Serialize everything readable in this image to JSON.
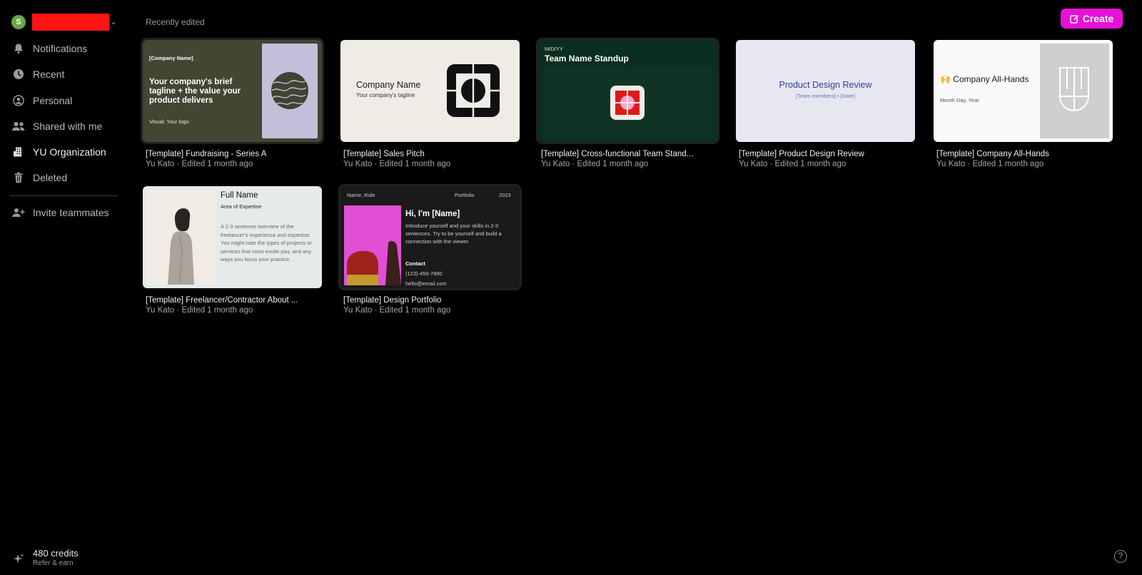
{
  "sidebar": {
    "workspace_avatar_letter": "S",
    "items": [
      {
        "label": "Notifications",
        "icon": "bell-icon"
      },
      {
        "label": "Recent",
        "icon": "clock-icon"
      },
      {
        "label": "Personal",
        "icon": "person-icon"
      },
      {
        "label": "Shared with me",
        "icon": "people-icon"
      },
      {
        "label": "YU Organization",
        "icon": "building-icon"
      },
      {
        "label": "Deleted",
        "icon": "trash-icon"
      },
      {
        "label": "Invite teammates",
        "icon": "add-person-icon"
      }
    ],
    "credits": {
      "count": "480 credits",
      "sub": "Refer & earn",
      "icon": "sparkle-icon"
    }
  },
  "main": {
    "section_title": "Recently edited",
    "create_label": "Create",
    "accent": "#e810d8",
    "cards": [
      {
        "title": "[Template] Fundraising - Series A",
        "meta": "Yu Kato · Edited 1 month ago",
        "thumb": {
          "label": "[Company Name]",
          "headline": "Your company's brief tagline + the value your product delivers",
          "foot": "Visual: Your logo"
        }
      },
      {
        "title": "[Template] Sales Pitch",
        "meta": "Yu Kato · Edited 1 month ago",
        "thumb": {
          "name": "Company Name",
          "tagline": "Your company's tagline"
        }
      },
      {
        "title": "[Template] Cross-functional Team Stand...",
        "meta": "Yu Kato · Edited 1 month ago",
        "thumb": {
          "date": "M/D/YY",
          "heading": "Team Name Standup"
        }
      },
      {
        "title": "[Template] Product Design Review",
        "meta": "Yu Kato · Edited 1 month ago",
        "thumb": {
          "heading": "Product Design Review",
          "sub": "[Team members] • [Date]"
        }
      },
      {
        "title": "[Template] Company All-Hands",
        "meta": "Yu Kato · Edited 1 month ago",
        "thumb": {
          "emoji": "🙌",
          "heading": "Company All-Hands",
          "date": "Month Day, Year"
        }
      },
      {
        "title": "[Template] Freelancer/Contractor About ...",
        "meta": "Yu Kato · Edited 1 month ago",
        "thumb": {
          "name": "Full Name",
          "area": "Area of Expertise",
          "body": "A 2-3 sentence overview of the freelancer's experience and expertise. You might note the types of projects or services that most excite you, and any ways you focus your practice."
        }
      },
      {
        "title": "[Template] Design Portfolio",
        "meta": "Yu Kato · Edited 1 month ago",
        "thumb": {
          "role": "Name, Role",
          "portfolio": "Portfolio",
          "year": "2023",
          "heading": "Hi, I'm [Name]",
          "intro": "Introduce yourself and your skills in 2-3 sentences. Try to be yourself and build a connection with the viewer.",
          "contact": "Contact",
          "phone": "(123)-456-7890",
          "email": "hello@email.com"
        }
      }
    ]
  },
  "help_label": "?"
}
